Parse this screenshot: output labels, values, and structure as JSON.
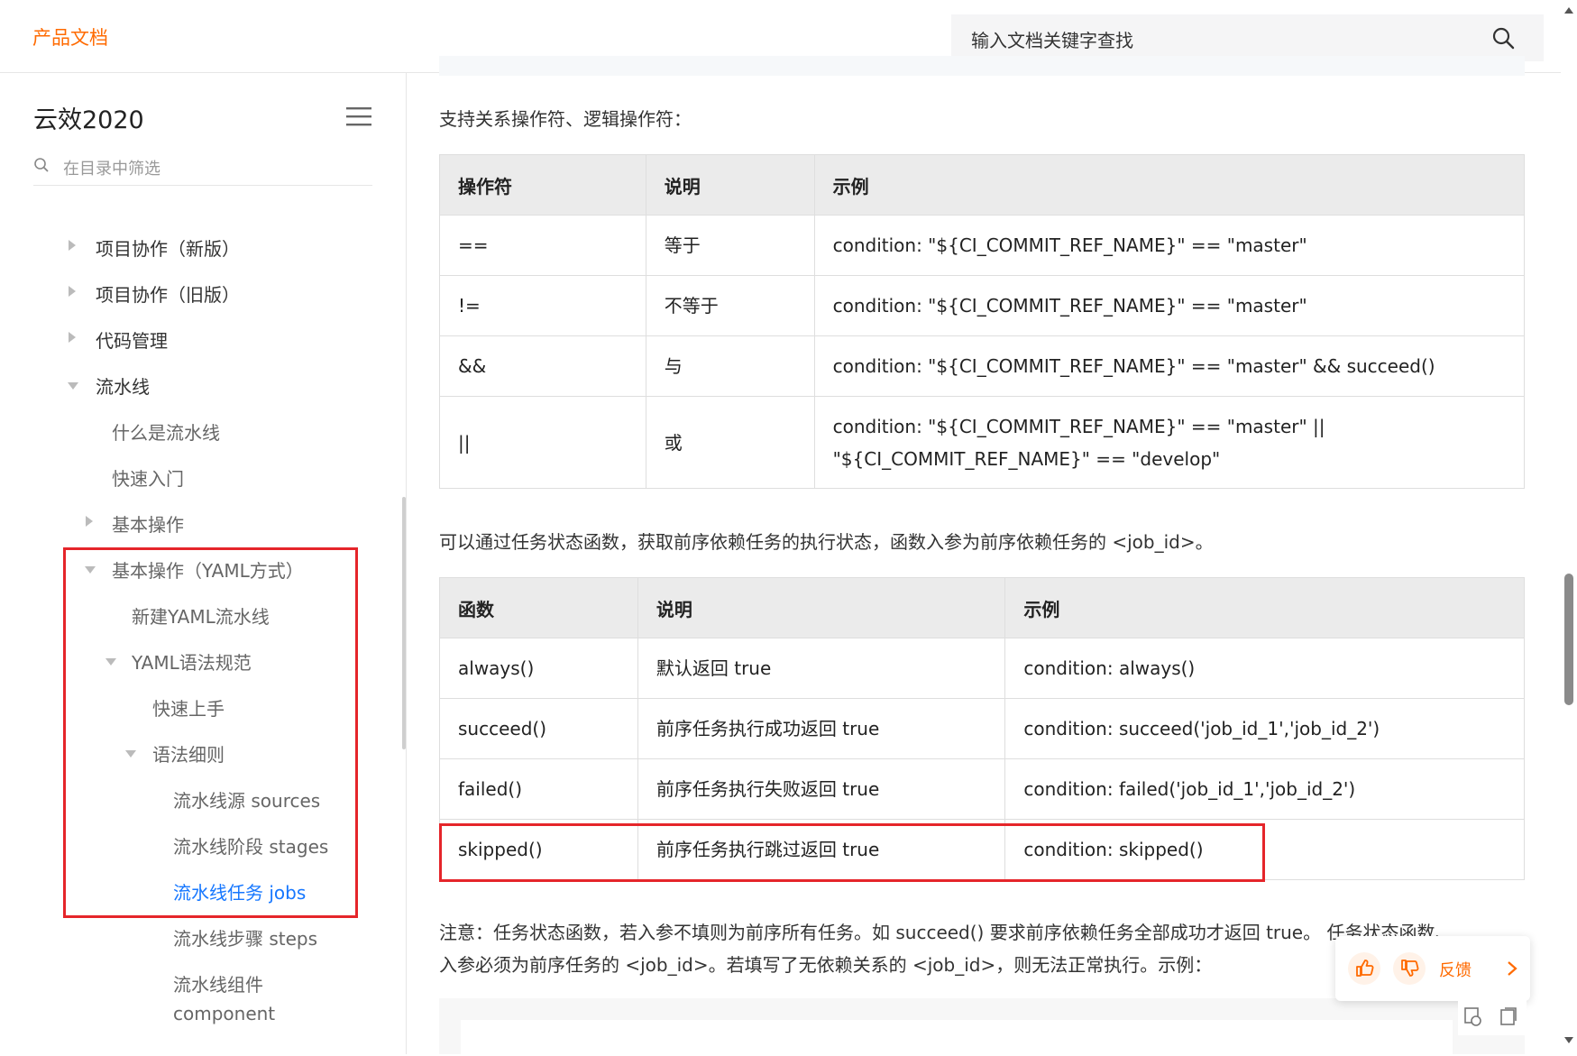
{
  "header": {
    "brand": "产品文档",
    "search_placeholder": "输入文档关键字查找"
  },
  "sidebar": {
    "title": "云效2020",
    "filter_placeholder": "在目录中筛选",
    "items": [
      {
        "label": "项目协作（新版）"
      },
      {
        "label": "项目协作（旧版）"
      },
      {
        "label": "代码管理"
      },
      {
        "label": "流水线"
      },
      {
        "label": "什么是流水线"
      },
      {
        "label": "快速入门"
      },
      {
        "label": "基本操作"
      },
      {
        "label": "基本操作（YAML方式）"
      },
      {
        "label": "新建YAML流水线"
      },
      {
        "label": "YAML语法规范"
      },
      {
        "label": "快速上手"
      },
      {
        "label": "语法细则"
      },
      {
        "label": "流水线源 sources"
      },
      {
        "label": "流水线阶段 stages"
      },
      {
        "label": "流水线任务 jobs"
      },
      {
        "label": "流水线步骤 steps"
      },
      {
        "label": "流水线组件"
      },
      {
        "label": "component"
      }
    ]
  },
  "content": {
    "intro": "支持关系操作符、逻辑操作符：",
    "ops_table": {
      "headers": [
        "操作符",
        "说明",
        "示例"
      ],
      "rows": [
        [
          "==",
          "等于",
          "condition: \"${CI_COMMIT_REF_NAME}\" == \"master\""
        ],
        [
          "!=",
          "不等于",
          "condition: \"${CI_COMMIT_REF_NAME}\" == \"master\""
        ],
        [
          "&&",
          "与",
          "condition: \"${CI_COMMIT_REF_NAME}\" == \"master\" && succeed()"
        ],
        [
          "||",
          "或",
          "condition: \"${CI_COMMIT_REF_NAME}\" == \"master\" ||",
          "\"${CI_COMMIT_REF_NAME}\" == \"develop\""
        ]
      ]
    },
    "para2": "可以通过任务状态函数，获取前序依赖任务的执行状态，函数入参为前序依赖任务的 <job_id>。",
    "func_table": {
      "headers": [
        "函数",
        "说明",
        "示例"
      ],
      "rows": [
        [
          "always()",
          "默认返回 true",
          "condition: always()"
        ],
        [
          "succeed()",
          "前序任务执行成功返回 true",
          "condition: succeed('job_id_1','job_id_2')"
        ],
        [
          "failed()",
          "前序任务执行失败返回 true",
          "condition: failed('job_id_1','job_id_2')"
        ],
        [
          "skipped()",
          "前序任务执行跳过返回 true",
          "condition: skipped()"
        ]
      ]
    },
    "note_line1": "注意：任务状态函数，若入参不填则为前序所有任务。如 succeed() 要求前序依赖任务全部成功才返回 true。 任务状态函数、",
    "note_line2": "入参必须为前序任务的 <job_id>。若填写了无依赖关系的 <job_id>，则无法正常执行。示例："
  },
  "feedback": {
    "label": "反馈",
    "accent": "#ff6a00"
  },
  "colors": {
    "brand": "#ff6a00",
    "active_link": "#1677ff",
    "highlight_box": "#e5252a"
  }
}
